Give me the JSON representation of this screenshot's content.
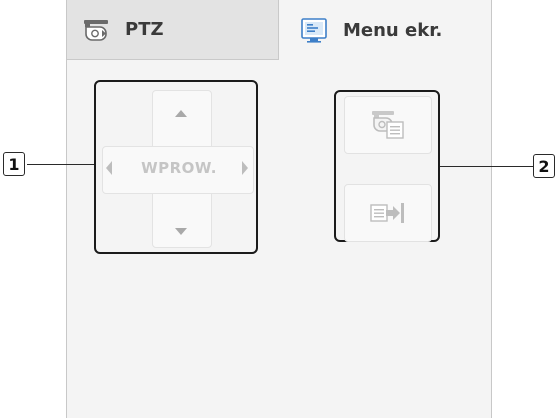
{
  "tabs": [
    {
      "label": "PTZ",
      "icon": "ptz-camera-icon"
    },
    {
      "label": "Menu ekr.",
      "icon": "osd-menu-icon"
    }
  ],
  "dpad": {
    "enter_label": "WPROW.",
    "arrows": [
      "up-arrow-icon",
      "down-arrow-icon",
      "left-arrow-icon",
      "right-arrow-icon"
    ]
  },
  "side_buttons": [
    {
      "icon": "camera-menu-icon"
    },
    {
      "icon": "exit-menu-icon"
    }
  ],
  "callouts": [
    {
      "number": "1"
    },
    {
      "number": "2"
    }
  ]
}
